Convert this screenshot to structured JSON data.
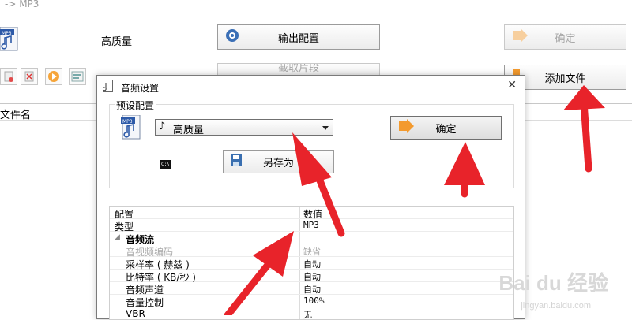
{
  "app": {
    "title": "-> MP3"
  },
  "main": {
    "quality_label": "高质量",
    "output_config_label": "输出配置",
    "clip_label": "截取片段",
    "ok_label": "确定",
    "add_file_label": "添加文件",
    "filename_header": "文件名"
  },
  "dialog": {
    "title": "音频设置",
    "preset_group_label": "预设配置",
    "preset_value": "高质量",
    "ok_label": "确定",
    "save_as_label": "另存为",
    "grid": {
      "header": {
        "config": "配置",
        "value": "数值"
      },
      "rows": [
        {
          "name": "类型",
          "value": "MP3"
        },
        {
          "name": "音频流",
          "value": ""
        },
        {
          "name": "音视频编码",
          "value": "缺省"
        },
        {
          "name": "采样率 ( 赫兹 )",
          "value": "自动"
        },
        {
          "name": "比特率 ( KB/秒 )",
          "value": "自动"
        },
        {
          "name": "音频声道",
          "value": "自动"
        },
        {
          "name": "音量控制",
          "value": "100%"
        },
        {
          "name": "VBR",
          "value": "无"
        }
      ]
    }
  },
  "watermark": {
    "main": "Bai du 经验",
    "sub": "jingyan.baidu.com"
  },
  "colors": {
    "arrow": "#e8232a",
    "ok_icon": "#f39a2e"
  }
}
